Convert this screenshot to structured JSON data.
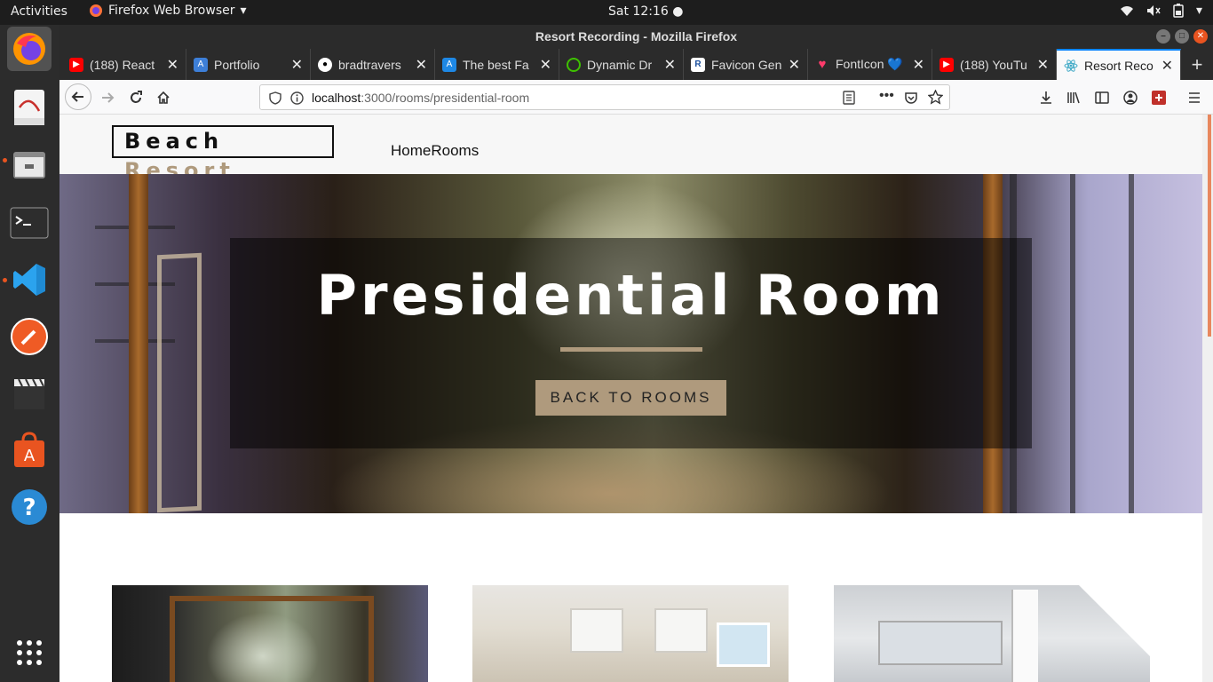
{
  "system": {
    "activities": "Activities",
    "app_name": "Firefox Web Browser",
    "clock": "Sat 12:16"
  },
  "dock": {
    "items": [
      "firefox-icon",
      "evince-icon",
      "file-manager-icon",
      "terminal-icon",
      "vscode-icon",
      "postman-icon",
      "video-editor-icon",
      "app-store-icon",
      "help-icon",
      "show-apps-icon"
    ]
  },
  "browser": {
    "window_title": "Resort Recording - Mozilla Firefox",
    "tabs": [
      {
        "label": "(188) React",
        "icon": "youtube-icon"
      },
      {
        "label": "Portfolio",
        "icon": "portfolio-icon"
      },
      {
        "label": "bradtravers",
        "icon": "github-icon"
      },
      {
        "label": "The best Fa",
        "icon": "favicon-a-icon"
      },
      {
        "label": "Dynamic Dr",
        "icon": "dynamic-drive-icon"
      },
      {
        "label": "Favicon Gen",
        "icon": "favicon-r-icon"
      },
      {
        "label": "FontIcon 💙",
        "icon": "heart-icon"
      },
      {
        "label": "(188) YouTu",
        "icon": "youtube-icon"
      },
      {
        "label": "Resort Reco",
        "icon": "react-icon"
      }
    ],
    "url_host": "localhost",
    "url_path": ":3000/rooms/presidential-room",
    "accent": "#0a84ff"
  },
  "site": {
    "logo_main": "Beach",
    "logo_accent": "Resort",
    "nav": {
      "home": "Home",
      "rooms": "Rooms"
    },
    "hero": {
      "title": "Presidential Room",
      "button": "BACK TO ROOMS"
    },
    "accent_color": "#af9a7d"
  }
}
